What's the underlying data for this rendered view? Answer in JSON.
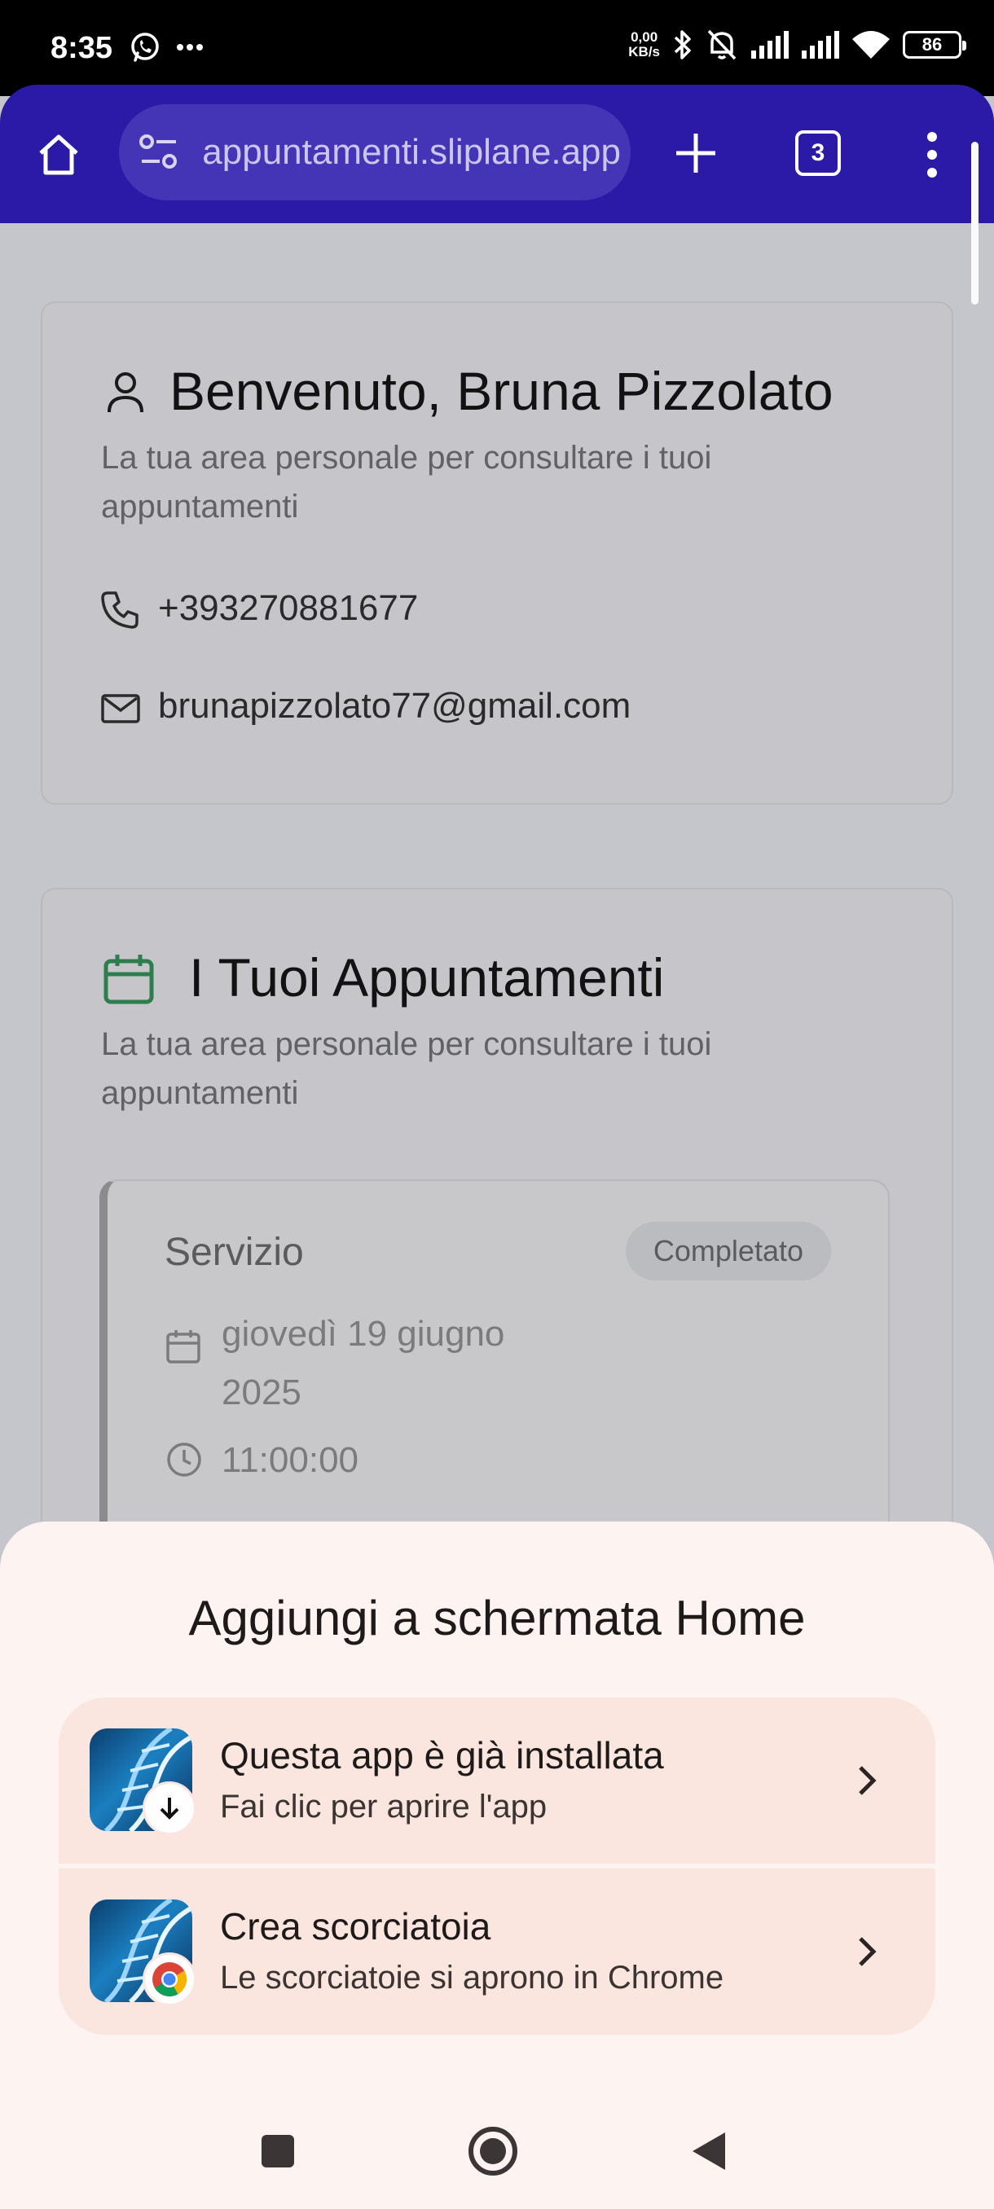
{
  "status_bar": {
    "time": "8:35",
    "net_speed_value": "0,00",
    "net_speed_unit": "KB/s",
    "battery": "86",
    "icons": [
      "whatsapp-icon",
      "more-icon",
      "bluetooth-icon",
      "bell-off-icon",
      "signal-icon",
      "signal-icon",
      "wifi-icon",
      "battery-icon"
    ]
  },
  "browser": {
    "url": "appuntamenti.sliplane.app",
    "tab_count": "3",
    "icons": [
      "home-icon",
      "tune-icon",
      "plus-icon",
      "tabs-icon",
      "menu-icon"
    ],
    "toolbar_color": "#2a1aa5"
  },
  "profile_card": {
    "title": "Benvenuto, Bruna Pizzolato",
    "subtitle": "La tua area personale per consultare i tuoi appuntamenti",
    "phone": "+393270881677",
    "email": "brunapizzolato77@gmail.com"
  },
  "appointments_card": {
    "title": "I Tuoi Appuntamenti",
    "subtitle": "La tua area personale per consultare i tuoi appuntamenti",
    "accent_color": "#2e7d4f",
    "appointments": [
      {
        "service": "Servizio",
        "status": "Completato",
        "date": "giovedì 19 giugno 2025",
        "time": "11:00:00"
      }
    ]
  },
  "bottom_sheet": {
    "title": "Aggiungi a schermata Home",
    "options": [
      {
        "title": "Questa app è già installata",
        "description": "Fai clic per aprire l'app",
        "badge": "download-icon"
      },
      {
        "title": "Crea scorciatoia",
        "description": "Le scorciatoie si aprono in Chrome",
        "badge": "chrome-icon"
      }
    ]
  },
  "nav_bar": {
    "buttons": [
      "recents-button",
      "home-button",
      "back-button"
    ]
  }
}
